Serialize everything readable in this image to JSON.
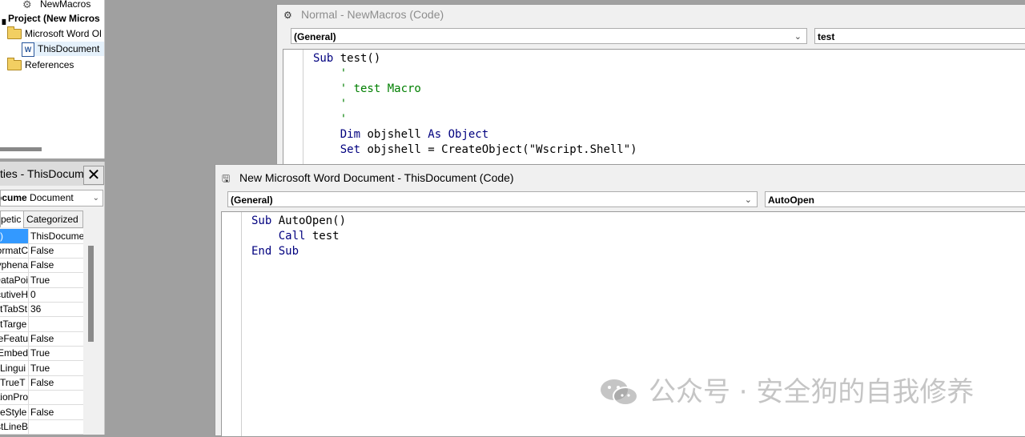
{
  "project_tree": {
    "items": [
      {
        "label": "NewMacros",
        "icon": "module-gear-icon"
      },
      {
        "label": "Project (New Micros",
        "icon": "project-icon"
      },
      {
        "label": "Microsoft Word Ol",
        "icon": "folder-icon"
      },
      {
        "label": "ThisDocument",
        "icon": "word-document-icon"
      },
      {
        "label": "References",
        "icon": "folder-icon"
      }
    ]
  },
  "properties": {
    "title": "ties - ThisDocum",
    "close_label": "✕",
    "object_combo_bold": "ocume",
    "object_combo_type": "Document",
    "tabs": [
      "petic",
      "Categorized"
    ],
    "rows": [
      {
        "name": ")",
        "value": "ThisDocume"
      },
      {
        "name": "ormatC",
        "value": "False"
      },
      {
        "name": "yphena",
        "value": "False"
      },
      {
        "name": "DataPoi",
        "value": "True"
      },
      {
        "name": "cutiveH",
        "value": "0"
      },
      {
        "name": "tTabSt",
        "value": "36"
      },
      {
        "name": "tTarge",
        "value": ""
      },
      {
        "name": "eFeatu",
        "value": "False"
      },
      {
        "name": "Embed",
        "value": "True"
      },
      {
        "name": "Lingui",
        "value": "True"
      },
      {
        "name": "TrueT",
        "value": "False"
      },
      {
        "name": "tionPro",
        "value": ""
      },
      {
        "name": "eStyle",
        "value": "False"
      },
      {
        "name": "stLineB",
        "value": ""
      }
    ]
  },
  "back_window": {
    "title": "Normal - NewMacros (Code)",
    "object_combo": "(General)",
    "proc_combo": "test",
    "code": [
      [
        {
          "t": "Sub ",
          "c": "kw"
        },
        {
          "t": "test()",
          "c": ""
        }
      ],
      [
        {
          "t": "    '",
          "c": "cm"
        }
      ],
      [
        {
          "t": "    ' test Macro",
          "c": "cm"
        }
      ],
      [
        {
          "t": "    '",
          "c": "cm"
        }
      ],
      [
        {
          "t": "    '",
          "c": "cm"
        }
      ],
      [
        {
          "t": "    Dim ",
          "c": "kw"
        },
        {
          "t": "objshell ",
          "c": ""
        },
        {
          "t": "As Object",
          "c": "kw"
        }
      ],
      [
        {
          "t": "    Set ",
          "c": "kw"
        },
        {
          "t": "objshell = CreateObject(\"Wscript.Shell\")",
          "c": ""
        }
      ]
    ]
  },
  "front_window": {
    "title": "New Microsoft Word Document - ThisDocument (Code)",
    "object_combo": "(General)",
    "proc_combo": "AutoOpen",
    "code": [
      [
        {
          "t": "Sub ",
          "c": "kw"
        },
        {
          "t": "AutoOpen()",
          "c": ""
        }
      ],
      [
        {
          "t": "    Call ",
          "c": "kw"
        },
        {
          "t": "test",
          "c": ""
        }
      ],
      [
        {
          "t": "End Sub",
          "c": "kw"
        }
      ]
    ]
  },
  "watermark": {
    "text": "公众号 · 安全狗的自我修养",
    "icon": "wechat-icon"
  },
  "colors": {
    "keyword": "#00007f",
    "comment": "#007f00",
    "selected_row": "#3399ff",
    "mdi_background": "#a0a0a0"
  }
}
